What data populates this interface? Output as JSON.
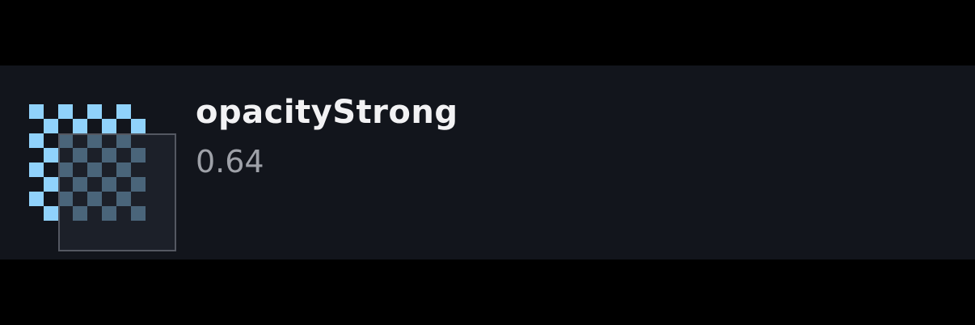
{
  "token": {
    "name": "opacityStrong",
    "value": "0.64"
  },
  "colors": {
    "background": "#000000",
    "row_background": "#12151c",
    "checker_light": "#90d2fb",
    "overlay_border": "#545862",
    "name_text": "#f2f2f4",
    "value_text": "#9ea1a8"
  },
  "icons": {
    "swatch": "opacity-swatch-icon"
  }
}
